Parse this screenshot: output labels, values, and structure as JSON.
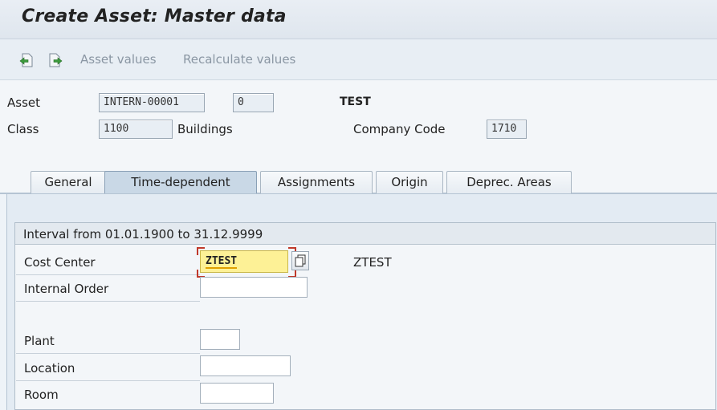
{
  "window": {
    "title": "Create Asset: Master data"
  },
  "toolbar": {
    "icons": [
      "previous-screen-icon",
      "next-screen-icon"
    ],
    "asset_values": "Asset values",
    "recalculate_values": "Recalculate values"
  },
  "header": {
    "asset_label": "Asset",
    "asset_number": "INTERN-00001",
    "sub_number": "0",
    "asset_description": "TEST",
    "class_label": "Class",
    "class_value": "1100",
    "class_description": "Buildings",
    "company_code_label": "Company Code",
    "company_code_value": "1710"
  },
  "tabs": [
    {
      "label": "General",
      "active": false
    },
    {
      "label": "Time-dependent",
      "active": true
    },
    {
      "label": "Assignments",
      "active": false
    },
    {
      "label": "Origin",
      "active": false
    },
    {
      "label": "Deprec. Areas",
      "active": false
    }
  ],
  "interval": {
    "title": "Interval from 01.01.1900 to 31.12.9999",
    "cost_center_label": "Cost Center",
    "cost_center_value": "ZTEST",
    "cost_center_description": "ZTEST",
    "internal_order_label": "Internal Order",
    "internal_order_value": "",
    "plant_label": "Plant",
    "plant_value": "",
    "location_label": "Location",
    "location_value": "",
    "room_label": "Room",
    "room_value": ""
  },
  "colors": {
    "accent_tab": "#c9d8e6",
    "focus_field": "#fdf196",
    "focus_corner": "#c0392b"
  }
}
